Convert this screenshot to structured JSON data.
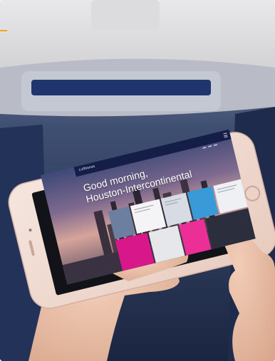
{
  "screen": {
    "brand": "Lufthansa",
    "greeting_line1": "Good morning,",
    "greeting_line2": "Houston-Intercontinental"
  },
  "colors": {
    "nav_bar": "#151e46",
    "tile_magenta": "#d8188a",
    "tile_blue": "#3a9ad8",
    "phone_body": "#f1dcd3",
    "accent_line": "#f2a51a"
  }
}
